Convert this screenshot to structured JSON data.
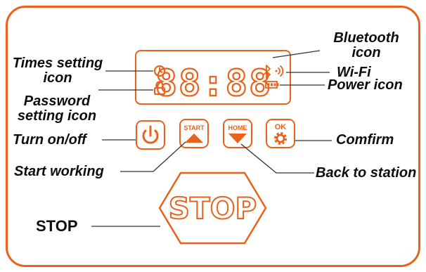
{
  "colors": {
    "accent": "#E8621C",
    "line": "#333333",
    "text": "#0d0d0d"
  },
  "display": {
    "digits": "88:88"
  },
  "buttons": {
    "power": {
      "icon": "power-icon"
    },
    "start": {
      "label": "START",
      "icon": "triangle-up-icon"
    },
    "home": {
      "label": "HOME",
      "icon": "triangle-down-icon"
    },
    "ok": {
      "label": "OK",
      "icon": "gear-icon"
    },
    "stop": {
      "label": "STOP"
    }
  },
  "callouts": {
    "times_setting_line1": "Times setting",
    "times_setting_line2": "icon",
    "password_setting_line1": "Password",
    "password_setting_line2": "setting icon",
    "turn_on_off": "Turn on/off",
    "start_working": "Start working",
    "stop": "STOP",
    "bluetooth_line1": "Bluetooth",
    "bluetooth_line2": "icon",
    "wifi": "Wi-Fi",
    "power_icon": "Power icon",
    "confirm": "Comfirm",
    "back_to_station": "Back to station"
  }
}
